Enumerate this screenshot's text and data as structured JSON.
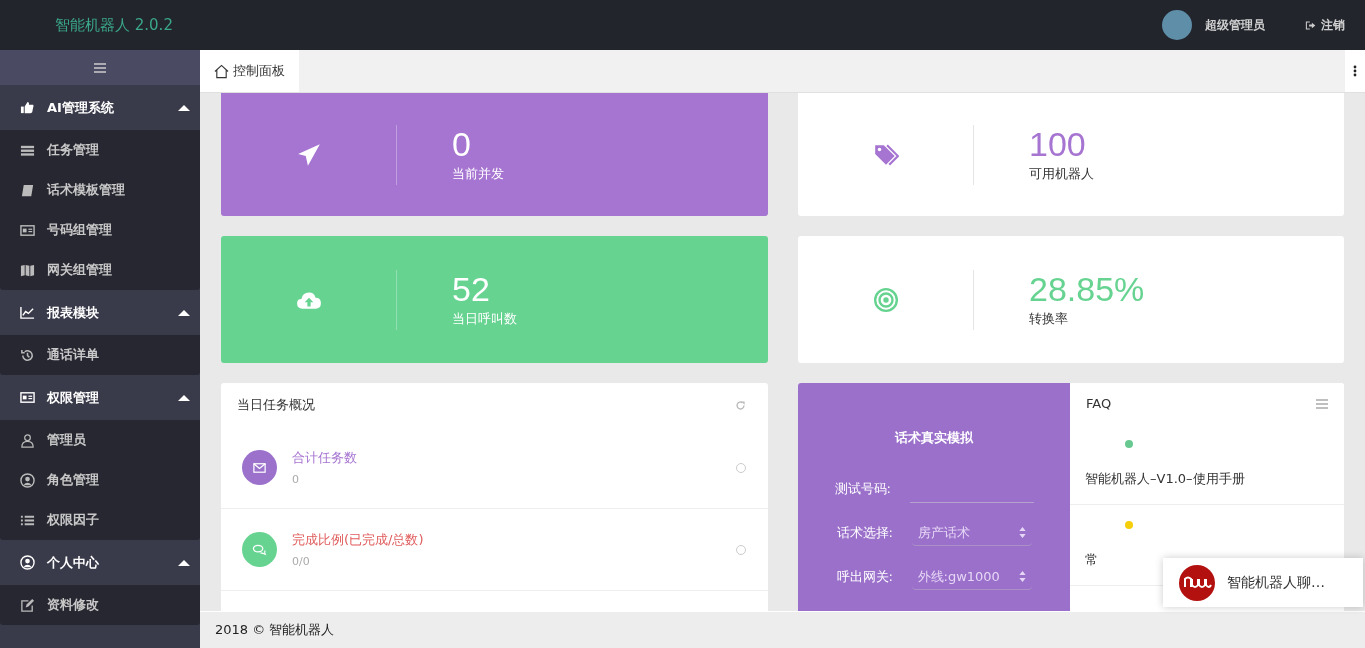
{
  "header": {
    "logo": "智能机器人 2.0.2",
    "user_name": "超级管理员",
    "logout": "注销"
  },
  "sidebar": {
    "groups": [
      {
        "label": "AI管理系统",
        "expanded": true,
        "items": [
          {
            "label": "任务管理"
          },
          {
            "label": "话术模板管理"
          },
          {
            "label": "号码组管理"
          },
          {
            "label": "网关组管理"
          }
        ]
      },
      {
        "label": "报表模块",
        "expanded": true,
        "items": [
          {
            "label": "通话详单"
          }
        ]
      },
      {
        "label": "权限管理",
        "expanded": true,
        "items": [
          {
            "label": "管理员"
          },
          {
            "label": "角色管理"
          },
          {
            "label": "权限因子"
          }
        ]
      },
      {
        "label": "个人中心",
        "expanded": true,
        "items": [
          {
            "label": "资料修改"
          }
        ]
      }
    ]
  },
  "tabs": [
    {
      "label": "控制面板",
      "selected": true
    }
  ],
  "stats": [
    {
      "kind": "filled",
      "color": "#a674d1",
      "value": "0",
      "label": "当前并发"
    },
    {
      "kind": "plain",
      "color": "#a674d1",
      "value": "100",
      "label": "可用机器人"
    },
    {
      "kind": "filled",
      "color": "#67d391",
      "value": "52",
      "label": "当日呼叫数"
    },
    {
      "kind": "plain",
      "color": "#67d391",
      "value": "28.85%",
      "label": "转换率"
    }
  ],
  "task_overview": {
    "title": "当日任务概况",
    "items": [
      {
        "color": "#9b71cc",
        "title": "合计任务数",
        "value": "0"
      },
      {
        "color": "#67d391",
        "title": "完成比例(已完成/总数)",
        "value": "0/0"
      }
    ]
  },
  "simulator": {
    "title": "话术真实模拟",
    "fields": [
      {
        "kind": "input",
        "label": "测试号码:"
      },
      {
        "kind": "select",
        "label": "话术选择:",
        "value": "房产话术"
      },
      {
        "kind": "select",
        "label": "呼出网关:",
        "value": "外线:gw1000"
      }
    ]
  },
  "faq": {
    "title": "FAQ",
    "items": [
      {
        "color": "#67c98f",
        "text": "智能机器人–V1.0–使用手册"
      },
      {
        "color": "#f5cf0a",
        "text": "常"
      }
    ]
  },
  "chat_popup": {
    "title": "智能机器人聊…"
  },
  "footer": "2018 © 智能机器人"
}
